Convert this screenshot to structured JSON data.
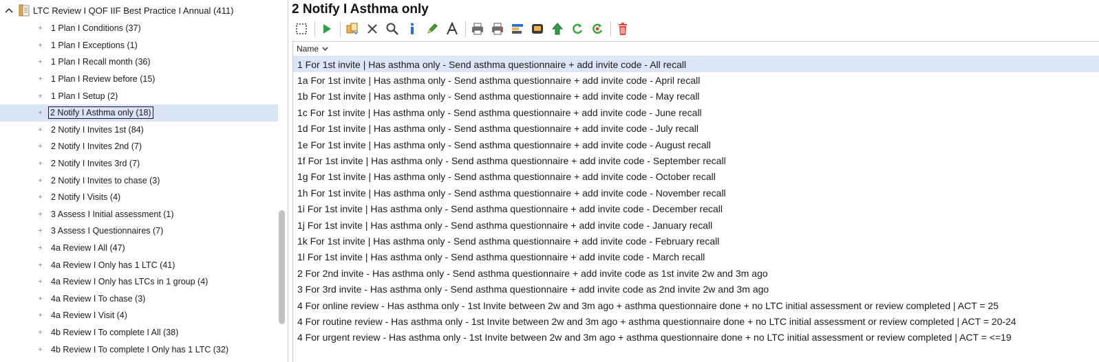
{
  "tree": {
    "root_label": "LTC Review I QOF IIF Best Practice I Annual (411)",
    "items": [
      {
        "label": "1 Plan I Conditions (37)",
        "selected": false
      },
      {
        "label": "1 Plan I Exceptions (1)",
        "selected": false
      },
      {
        "label": "1 Plan I Recall month (36)",
        "selected": false
      },
      {
        "label": "1 Plan I Review before (15)",
        "selected": false
      },
      {
        "label": "1 Plan I Setup (2)",
        "selected": false
      },
      {
        "label": "2 Notify I Asthma only (18)",
        "selected": true
      },
      {
        "label": "2 Notify I Invites 1st (84)",
        "selected": false
      },
      {
        "label": "2 Notify I Invites 2nd (7)",
        "selected": false
      },
      {
        "label": "2 Notify I Invites 3rd (7)",
        "selected": false
      },
      {
        "label": "2 Notify I Invites to chase (3)",
        "selected": false
      },
      {
        "label": "2 Notify I Visits (4)",
        "selected": false
      },
      {
        "label": "3 Assess I Initial assessment (1)",
        "selected": false
      },
      {
        "label": "3 Assess I Questionnaires (7)",
        "selected": false
      },
      {
        "label": "4a Review I All (47)",
        "selected": false
      },
      {
        "label": "4a Review I Only has 1 LTC (41)",
        "selected": false
      },
      {
        "label": "4a Review I Only has LTCs in 1 group (4)",
        "selected": false
      },
      {
        "label": "4a Review I To chase (3)",
        "selected": false
      },
      {
        "label": "4a Review I Visit (4)",
        "selected": false
      },
      {
        "label": "4b Review I To complete I All (38)",
        "selected": false
      },
      {
        "label": "4b Review I To complete I Only has 1 LTC (32)",
        "selected": false
      }
    ]
  },
  "main": {
    "title": "2 Notify I Asthma only",
    "column_header": "Name",
    "rows": [
      {
        "label": "1 For 1st invite | Has asthma only - Send asthma questionnaire + add invite code - All recall",
        "selected": true
      },
      {
        "label": "1a For 1st invite | Has asthma only - Send asthma questionnaire + add invite code - April recall",
        "selected": false
      },
      {
        "label": "1b For 1st invite | Has asthma only - Send asthma questionnaire + add invite code - May recall",
        "selected": false
      },
      {
        "label": "1c For 1st invite | Has asthma only - Send asthma questionnaire + add invite code - June recall",
        "selected": false
      },
      {
        "label": "1d For 1st invite | Has asthma only - Send asthma questionnaire + add invite code - July recall",
        "selected": false
      },
      {
        "label": "1e For 1st invite | Has asthma only - Send asthma questionnaire + add invite code - August recall",
        "selected": false
      },
      {
        "label": "1f For 1st invite | Has asthma only - Send asthma questionnaire + add invite code - September recall",
        "selected": false
      },
      {
        "label": "1g For 1st invite | Has asthma only - Send asthma questionnaire + add invite code - October recall",
        "selected": false
      },
      {
        "label": "1h For 1st invite | Has asthma only - Send asthma questionnaire + add invite code - November recall",
        "selected": false
      },
      {
        "label": "1i For 1st invite | Has asthma only - Send asthma questionnaire + add invite code - December recall",
        "selected": false
      },
      {
        "label": "1j For 1st invite | Has asthma only - Send asthma questionnaire + add invite code - January recall",
        "selected": false
      },
      {
        "label": "1k For 1st invite | Has asthma only - Send asthma questionnaire + add invite code - February recall",
        "selected": false
      },
      {
        "label": "1l For 1st invite | Has asthma only - Send asthma questionnaire + add invite code - March recall",
        "selected": false
      },
      {
        "label": "2 For 2nd invite - Has asthma only - Send asthma questionnaire + add invite code as 1st invite 2w and 3m ago",
        "selected": false
      },
      {
        "label": "3 For 3rd invite - Has asthma only - Send asthma questionnaire + add invite code as 2nd invite 2w and 3m ago",
        "selected": false
      },
      {
        "label": "4 For online review - Has asthma only - 1st Invite between 2w and 3m ago + asthma questionnaire done + no LTC initial assessment or review completed | ACT = 25",
        "selected": false
      },
      {
        "label": "4 For routine review - Has asthma only - 1st Invite between 2w and 3m ago + asthma questionnaire done + no LTC initial assessment or review completed | ACT = 20-24",
        "selected": false
      },
      {
        "label": "4 For urgent review - Has asthma only - 1st Invite between 2w and 3m ago + asthma questionnaire done + no LTC initial assessment or review completed | ACT = <=19",
        "selected": false
      }
    ]
  },
  "toolbar": {
    "icons": [
      "select-icon",
      "run-icon",
      "copy-icon",
      "delete-x-icon",
      "search-icon",
      "info-icon",
      "edit-pen-icon",
      "font-icon",
      "print-icon",
      "print-red-icon",
      "export-icon",
      "report-icon",
      "move-up-icon",
      "refresh-icon",
      "refresh-red-icon",
      "trash-icon"
    ]
  },
  "colors": {
    "selection_bg": "#dbe6f8",
    "run_green": "#2ea043",
    "info_blue": "#1e6fd9",
    "trash_red": "#e0463c"
  }
}
